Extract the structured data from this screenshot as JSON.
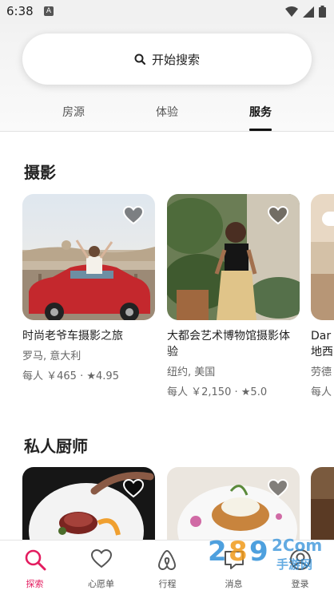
{
  "status": {
    "time": "6:38",
    "notif_icon": "A"
  },
  "search": {
    "placeholder": "开始搜索"
  },
  "tabs": [
    {
      "label": "房源",
      "active": false
    },
    {
      "label": "体验",
      "active": false
    },
    {
      "label": "服务",
      "active": true
    }
  ],
  "sections": [
    {
      "title": "摄影",
      "cards": [
        {
          "title": "时尚老爷车摄影之旅",
          "location": "罗马, 意大利",
          "price_prefix": "每人 ￥465",
          "rating": "4.95"
        },
        {
          "title": "大都会艺术博物馆摄影体验",
          "location": "纽约, 美国",
          "price_prefix": "每人 ￥2,150",
          "rating": "5.0"
        },
        {
          "title": "Dar",
          "title2": "地西",
          "location": "劳德",
          "price_prefix": "每人"
        }
      ]
    },
    {
      "title": "私人厨师",
      "cards": []
    }
  ],
  "bottom_nav": [
    {
      "label": "探索",
      "icon": "search-icon",
      "active": true
    },
    {
      "label": "心愿单",
      "icon": "heart-icon",
      "active": false
    },
    {
      "label": "行程",
      "icon": "airbnb-logo-icon",
      "active": false
    },
    {
      "label": "消息",
      "icon": "message-icon",
      "active": false
    },
    {
      "label": "登录",
      "icon": "profile-icon",
      "active": false
    }
  ],
  "watermark": {
    "text": "2Com",
    "sub": "手游网"
  },
  "colors": {
    "accent": "#e31c5f",
    "text": "#222222",
    "muted": "#666666"
  }
}
